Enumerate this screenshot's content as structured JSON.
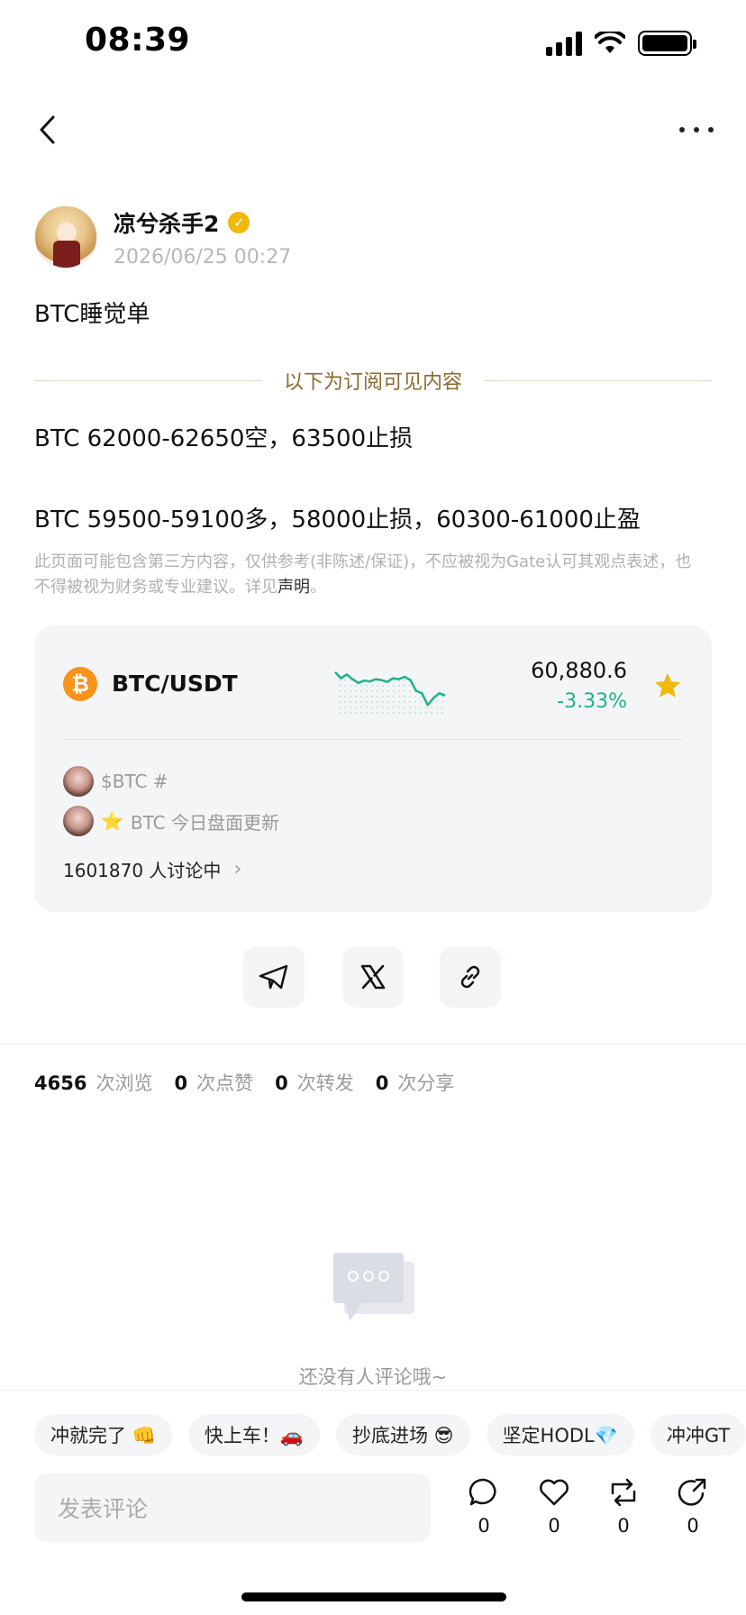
{
  "status_bar": {
    "time": "08:39"
  },
  "author": {
    "name": "凉兮杀手2",
    "time": "2026/06/25 00:27",
    "verified_icon": "verified-check-icon"
  },
  "post": {
    "title": "BTC睡觉单",
    "subscription_divider": "以下为订阅可见内容",
    "line1": "BTC 62000-62650空，63500止损",
    "line2": "BTC 59500-59100多，58000止损，60300-61000止盈",
    "disclaimer": "此页面可能包含第三方内容，仅供参考(非陈述/保证)，不应被视为Gate认可其观点表述，也不得被视为财务或专业建议。详见",
    "disclaimer_link": "声明",
    "disclaimer_end": "。"
  },
  "market": {
    "pair": "BTC/USDT",
    "price": "60,880.6",
    "change": "-3.33%",
    "change_color": "#1fb389",
    "coin_color": "#f7931a",
    "tags": [
      {
        "text": "$BTC #"
      },
      {
        "text": "BTC 今日盘面更新",
        "star": "⭐"
      }
    ],
    "discussion": "1601870 人讨论中",
    "spark_trend": [
      0.15,
      0.28,
      0.2,
      0.3,
      0.38,
      0.33,
      0.35,
      0.3,
      0.32,
      0.36,
      0.28,
      0.3,
      0.25,
      0.32,
      0.55,
      0.6,
      0.85,
      0.7,
      0.6,
      0.65
    ]
  },
  "share": {
    "icons": [
      "telegram-icon",
      "x-icon",
      "link-icon"
    ]
  },
  "stats": {
    "views": "4656",
    "views_label": "次浏览",
    "likes": "0",
    "likes_label": "次点赞",
    "reposts": "0",
    "reposts_label": "次转发",
    "shares": "0",
    "shares_label": "次分享"
  },
  "comments": {
    "empty_text": "还没有人评论哦~"
  },
  "bottom": {
    "chips": [
      "冲就完了 👊",
      "快上车！🚗",
      "抄底进场 😎",
      "坚定HODL💎",
      "冲冲GT"
    ],
    "input_placeholder": "发表评论",
    "actions": [
      {
        "icon": "comment-icon",
        "count": "0"
      },
      {
        "icon": "heart-icon",
        "count": "0"
      },
      {
        "icon": "repost-icon",
        "count": "0"
      },
      {
        "icon": "share-icon",
        "count": "0"
      }
    ]
  }
}
